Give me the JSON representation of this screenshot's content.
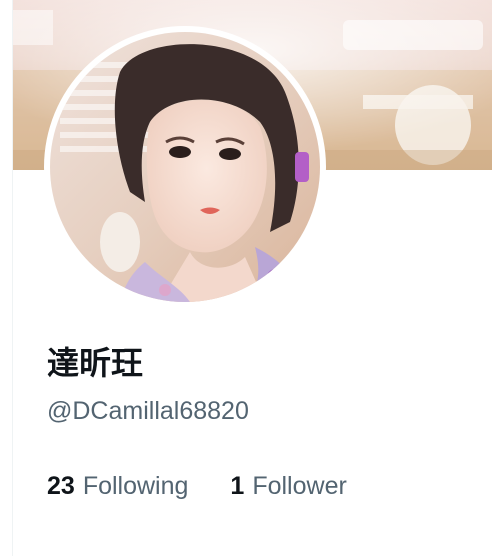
{
  "profile": {
    "display_name": "達昕玨",
    "handle": "@DCamillal68820"
  },
  "stats": {
    "following_count": "23",
    "following_label": "Following",
    "followers_count": "1",
    "followers_label": "Follower"
  },
  "colors": {
    "text_primary": "#0f1419",
    "text_secondary": "#536471",
    "background": "#ffffff"
  }
}
